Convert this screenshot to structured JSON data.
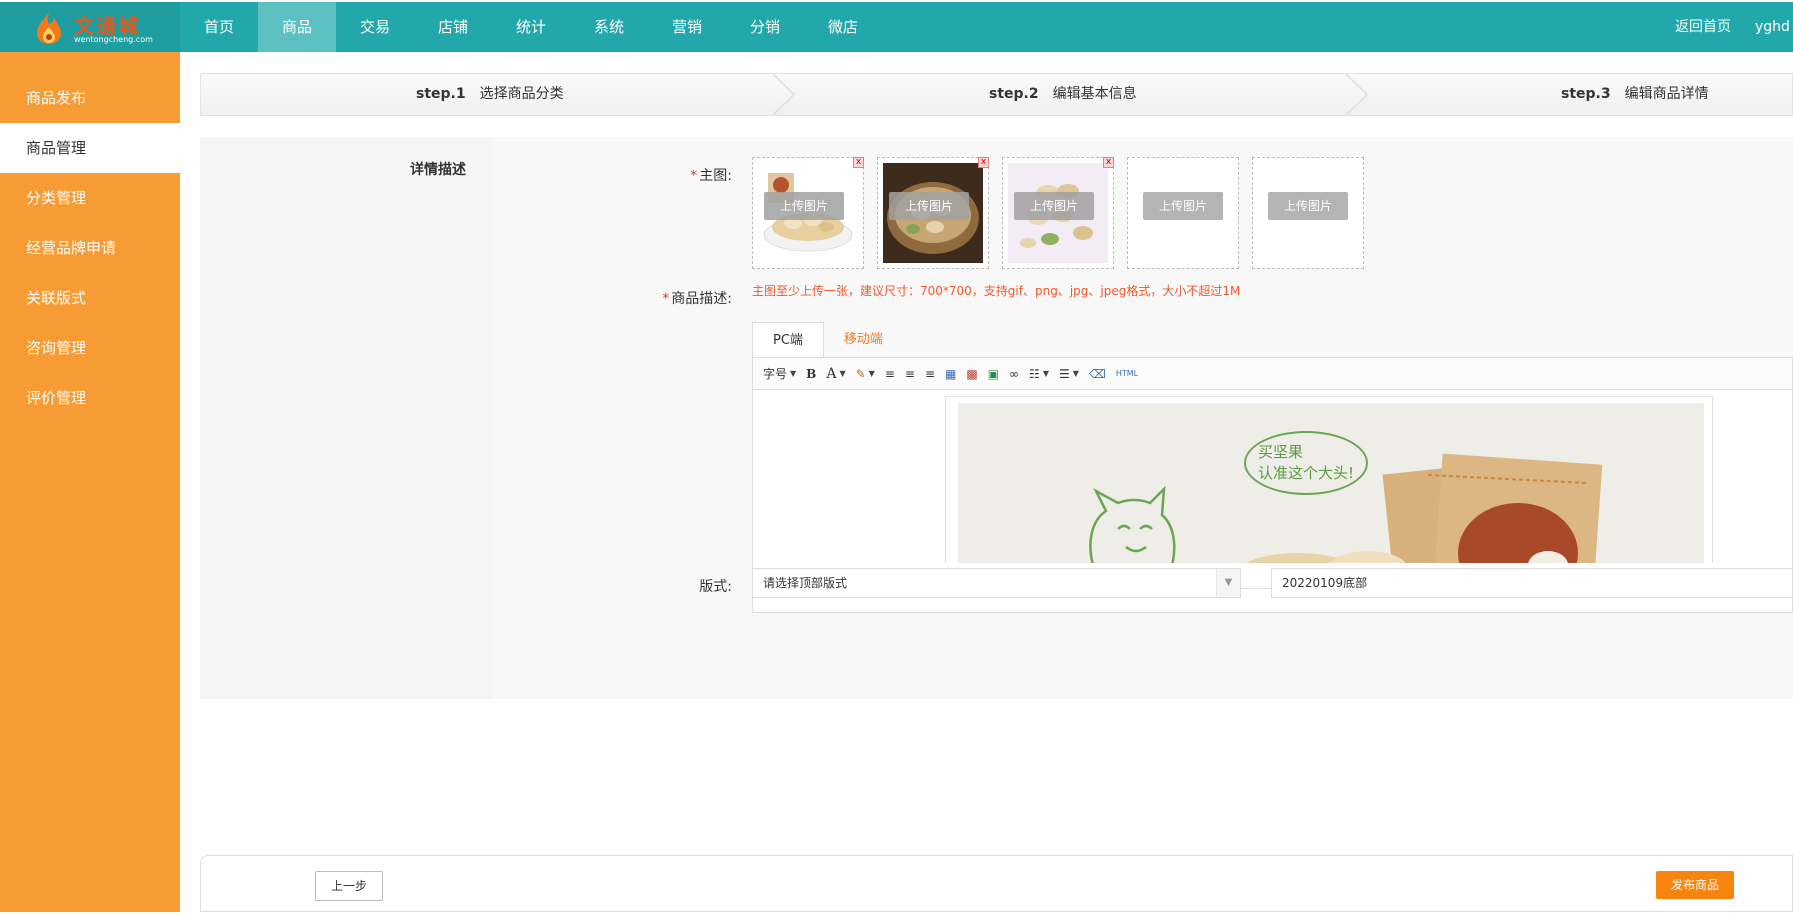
{
  "logo": {
    "title": "文通城",
    "sub": "wentongcheng.com"
  },
  "nav": [
    "首页",
    "商品",
    "交易",
    "店铺",
    "统计",
    "系统",
    "营销",
    "分销",
    "微店"
  ],
  "top_right": {
    "home": "返回首页",
    "user": "yghd"
  },
  "sidebar": [
    "商品发布",
    "商品管理",
    "分类管理",
    "经营品牌申请",
    "关联版式",
    "咨询管理",
    "评价管理"
  ],
  "steps": [
    {
      "no": "step.1",
      "label": "选择商品分类"
    },
    {
      "no": "step.2",
      "label": "编辑基本信息"
    },
    {
      "no": "step.3",
      "label": "编辑商品详情"
    }
  ],
  "section_label": "详情描述",
  "main_image": {
    "label": "主图:",
    "upload_label": "上传图片",
    "hint": "主图至少上传一张，建议尺寸：700*700，支持gif、png、jpg、jpeg格式，大小不超过1M",
    "delete_glyph": "x"
  },
  "description": {
    "label": "商品描述:",
    "tabs": [
      "PC端",
      "移动端"
    ],
    "toolbar": {
      "font_size": "字号",
      "bold": "B",
      "font_color": "A",
      "html": "HTML"
    },
    "ad_text_1": "买坚果",
    "ad_text_2": "认准这个大头!"
  },
  "layout": {
    "label": "版式:",
    "top_placeholder": "请选择顶部版式",
    "bottom_value": "20220109底部"
  },
  "buttons": {
    "prev": "上一步",
    "publish": "发布商品"
  },
  "colors": {
    "topbar": "#22a8ab",
    "sidebar": "#f79c34",
    "publish": "#f7840e",
    "hint": "#f0582b"
  }
}
